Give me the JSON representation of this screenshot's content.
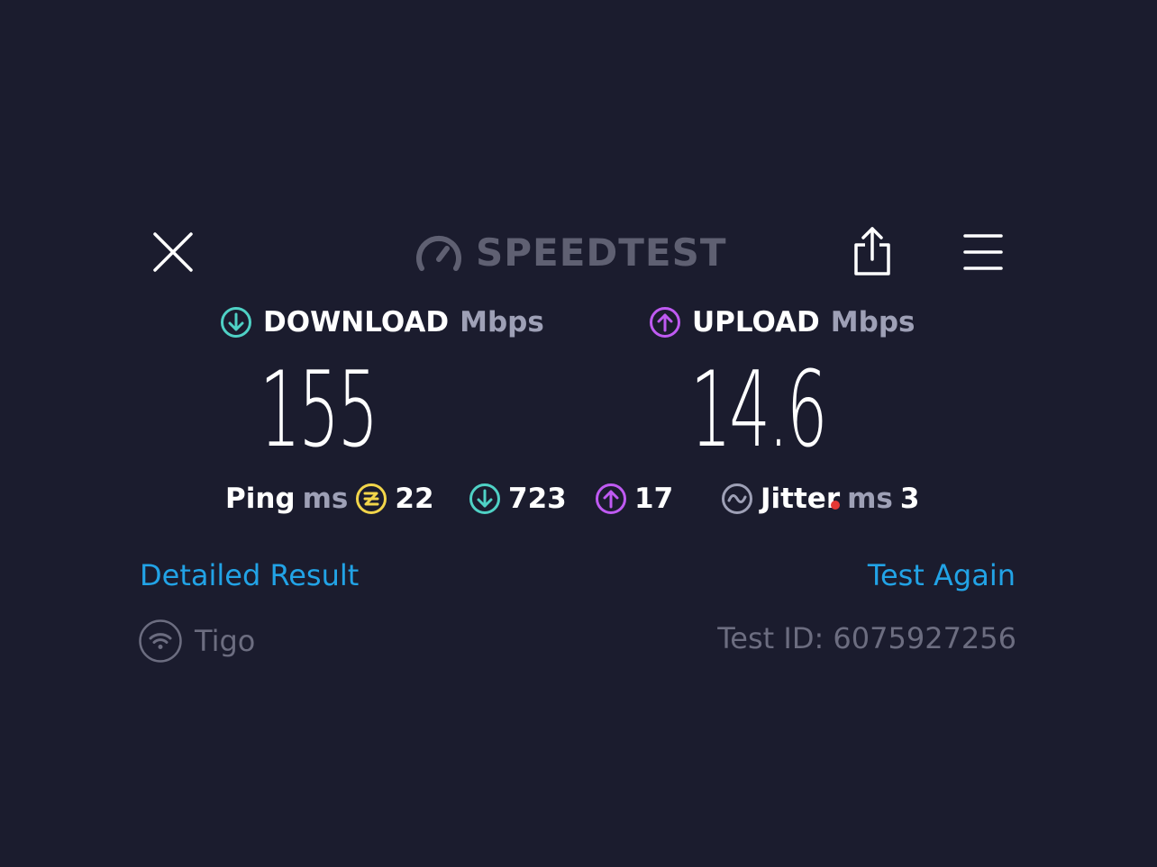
{
  "header": {
    "logo_text": "SPEEDTEST",
    "close_icon": "close-icon",
    "share_icon": "share-icon",
    "menu_icon": "hamburger-menu-icon"
  },
  "download": {
    "label": "DOWNLOAD",
    "unit": "Mbps",
    "value": "155",
    "icon": "download-arrow-icon",
    "color": "#4fd1c5"
  },
  "upload": {
    "label": "UPLOAD",
    "unit": "Mbps",
    "value": "14.6",
    "icon": "upload-arrow-icon",
    "color": "#bf5af2"
  },
  "ping": {
    "label": "Ping",
    "unit": "ms",
    "idle_value": "22",
    "idle_color": "#f2d54a",
    "download_value": "723",
    "upload_value": "17"
  },
  "jitter": {
    "label": "Jitter",
    "unit": "ms",
    "value": "3"
  },
  "links": {
    "detailed": "Detailed Result",
    "again": "Test Again"
  },
  "footer": {
    "provider": "Tigo",
    "test_id": "Test ID: 6075927256",
    "provider_icon": "wifi-icon"
  },
  "colors": {
    "background": "#1b1c2e",
    "link": "#22a3e6",
    "muted": "#9ea0b6"
  }
}
